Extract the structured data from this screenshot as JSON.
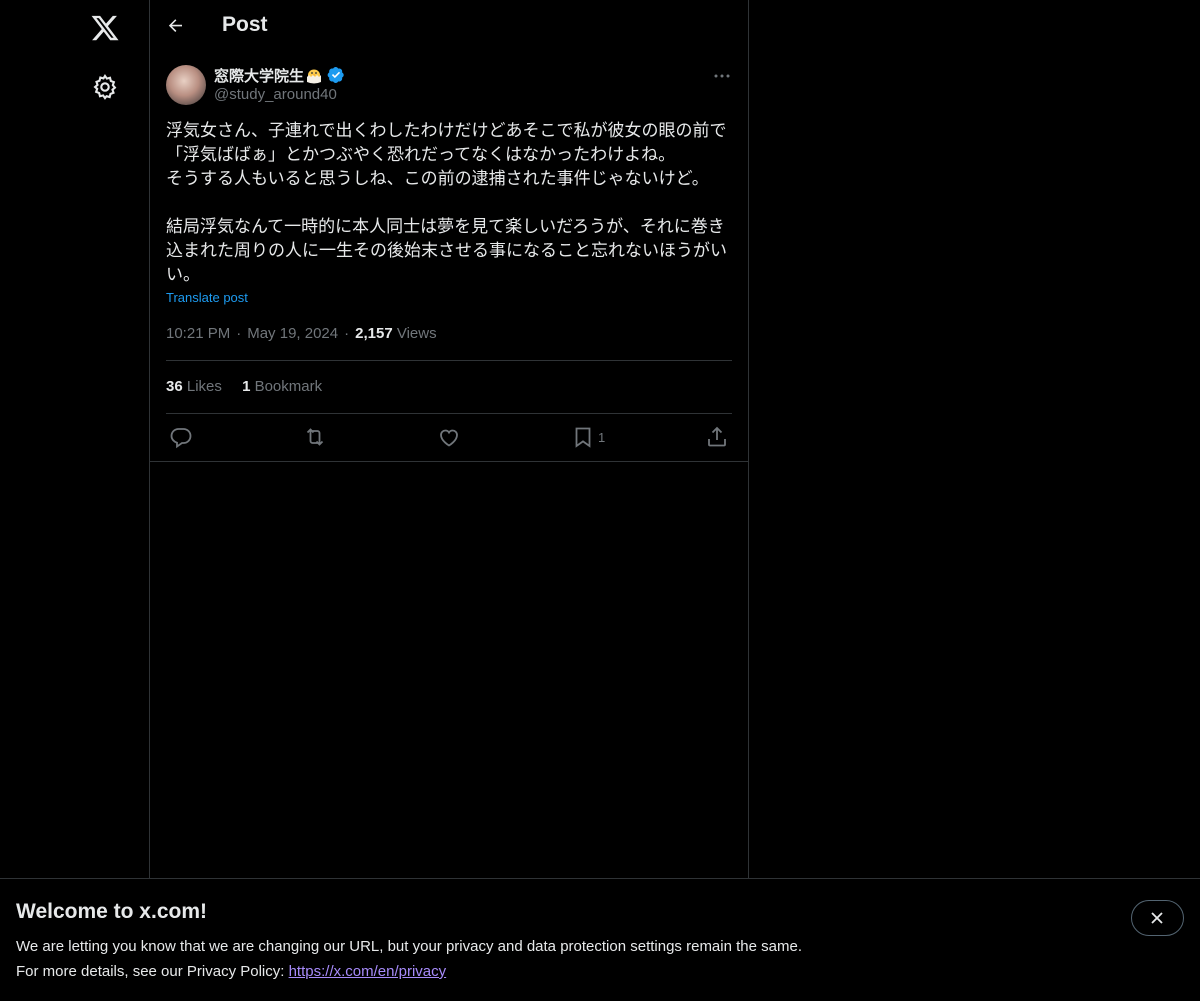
{
  "header": {
    "title": "Post"
  },
  "tweet": {
    "author_name": "窓際大学院生",
    "handle": "@study_around40",
    "text_lines": [
      "浮気女さん、子連れで出くわしたわけだけどあそこで私が彼女の眼の前で",
      "「浮気ばばぁ」とかつぶやく恐れだってなくはなかったわけよね。",
      "そうする人もいると思うしね、この前の逮捕された事件じゃないけど。",
      "結局浮気なんて一時的に本人同士は夢を見て楽しいだろうが、それに巻き",
      "込まれた周りの人に一生その後始末させる事になること忘れないほうがい",
      "い。"
    ],
    "translate_label": "Translate post",
    "time": "10:21 PM",
    "date": "May 19, 2024",
    "separator": "·",
    "views_count": "2,157",
    "views_label": "Views",
    "likes_count": "36",
    "likes_label": "Likes",
    "bookmarks_count": "1",
    "bookmarks_label": "Bookmark",
    "bookmark_action_count": "1"
  },
  "icons": {
    "logo": "x-logo-icon",
    "settings": "gear-icon",
    "back": "arrow-left-icon",
    "more": "more-horizontal-icon",
    "verified": "verified-badge-icon",
    "emoji": "hatching-chick-emoji-icon",
    "reply": "reply-icon",
    "repost": "repost-icon",
    "like": "heart-icon",
    "bookmark": "bookmark-icon",
    "share": "share-icon",
    "close": "close-icon"
  },
  "banner": {
    "title": "Welcome to x.com!",
    "line1": "We are letting you know that we are changing our URL, but your privacy and data protection settings remain the same.",
    "line2_prefix": "For more details, see our Privacy Policy: ",
    "link": "https://x.com/en/privacy"
  },
  "colors": {
    "background": "#000000",
    "text": "#e7e9ea",
    "muted": "#71767b",
    "accent": "#1d9bf0",
    "divider": "#2f3336",
    "link_visited": "#a78bfa"
  }
}
